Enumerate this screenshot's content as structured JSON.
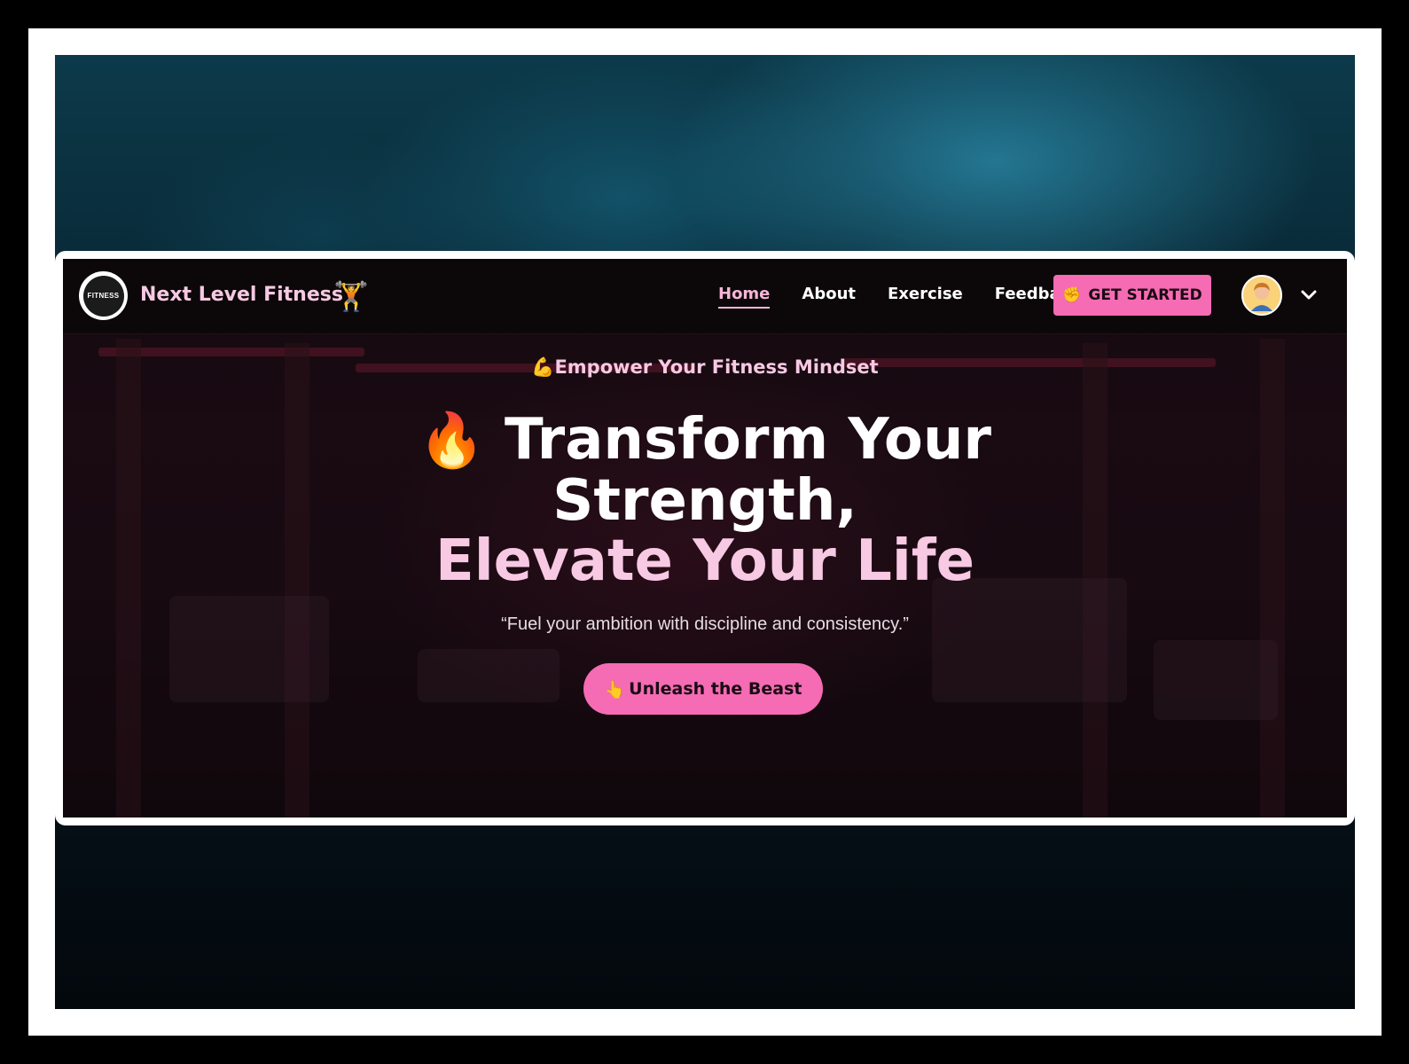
{
  "navbar": {
    "logo_text": "FITNESS",
    "brand": "Next Level Fitness",
    "brand_icon": "🏋️",
    "links": [
      {
        "label": "Home",
        "active": true
      },
      {
        "label": "About",
        "active": false
      },
      {
        "label": "Exercise",
        "active": false
      },
      {
        "label": "Feedback",
        "active": false
      }
    ],
    "cta_icon": "✊",
    "cta_label": "GET STARTED",
    "avatar_icon": "user-avatar-icon",
    "dropdown_icon": "chevron-down-icon"
  },
  "hero": {
    "tag_icon": "💪",
    "tag": "Empower Your Fitness Mindset",
    "title_icon": "🔥",
    "title_line1": "Transform Your",
    "title_line2": "Strength,",
    "title_line3": "Elevate Your Life",
    "quote": "“Fuel your ambition with discipline and consistency.”",
    "button_icon": "👆",
    "button_label": "Unleash the Beast"
  },
  "colors": {
    "accent_pink": "#f56bb4",
    "light_pink": "#f7c9e3",
    "nav_bg": "#0c0809"
  }
}
